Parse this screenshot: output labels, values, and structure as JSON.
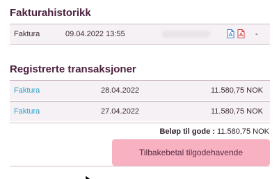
{
  "invoice_history": {
    "title": "Fakturahistorikk",
    "rows": [
      {
        "type": "Faktura",
        "datetime": "09.04.2022 13:55",
        "trailing": "-",
        "icons": [
          "pdf-icon-blue",
          "pdf-icon-red"
        ]
      }
    ]
  },
  "transactions": {
    "title": "Registrerte transaksjoner",
    "rows": [
      {
        "type": "Faktura",
        "date": "28.04.2022",
        "amount": "11.580,75 NOK"
      },
      {
        "type": "Faktura",
        "date": "27.04.2022",
        "amount": "11.580,75 NOK"
      }
    ],
    "summary_label": "Beløp til gode :",
    "summary_value": "11.580,75 NOK",
    "refund_label": "Tilbakebetal tilgodehavende"
  },
  "colors": {
    "heading": "#4a1f3d",
    "link": "#2aa0c8",
    "row_bg": "#f6f1f4",
    "button_bg": "#f7b1c1",
    "pdf_blue": "#3a7fd0",
    "pdf_red": "#d23a3a"
  }
}
